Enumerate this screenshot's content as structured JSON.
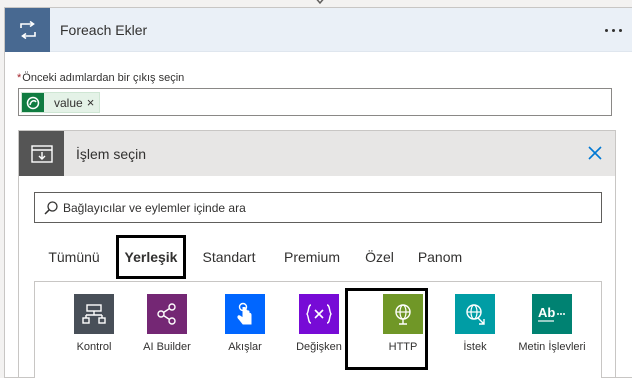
{
  "foreach": {
    "title": "Foreach Ekler",
    "field_label": "Önceki adımlardan bir çıkış seçin",
    "required_marker": "*",
    "token": {
      "label": "value",
      "remove": "×"
    }
  },
  "action_picker": {
    "title": "İşlem seçin",
    "search": {
      "placeholder": "Bağlayıcılar ve eylemler içinde ara",
      "value": ""
    },
    "tabs": [
      {
        "label": "Tümünü",
        "selected": false
      },
      {
        "label": "Yerleşik",
        "selected": true
      },
      {
        "label": "Standart",
        "selected": false
      },
      {
        "label": "Premium",
        "selected": false
      },
      {
        "label": "Özel",
        "selected": false
      },
      {
        "label": "Panom",
        "selected": false
      }
    ],
    "connectors": [
      {
        "label": "Kontrol",
        "color": "#484f58",
        "icon": "control-icon"
      },
      {
        "label": "AI Builder",
        "color": "#742774",
        "icon": "ai-builder-icon"
      },
      {
        "label": "Akışlar",
        "color": "#0066ff",
        "icon": "flows-icon"
      },
      {
        "label": "Değişken",
        "color": "#770bd6",
        "icon": "variable-icon"
      },
      {
        "label": "HTTP",
        "color": "#709727",
        "icon": "http-globe-icon"
      },
      {
        "label": "İstek",
        "color": "#009da5",
        "icon": "request-globe-icon"
      },
      {
        "label": "Metin İşlevleri",
        "color": "#008272",
        "icon": "text-functions-icon"
      }
    ]
  },
  "colors": {
    "header_accent": "#486991",
    "token_accent": "#107c41",
    "close_blue": "#0078d4"
  }
}
